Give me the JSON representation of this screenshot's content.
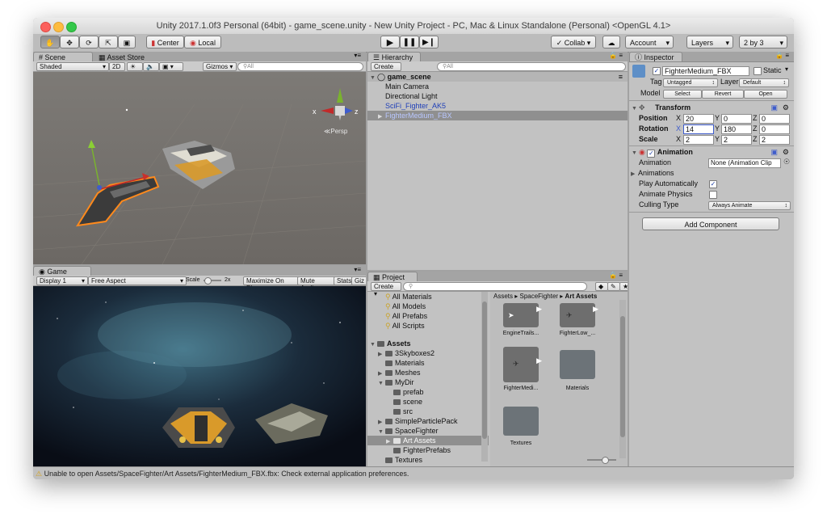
{
  "window": {
    "title": "Unity 2017.1.0f3 Personal (64bit) - game_scene.unity - New Unity Project - PC, Mac & Linux Standalone (Personal) <OpenGL 4.1>"
  },
  "toolbar": {
    "center_label": "Center",
    "local_label": "Local",
    "collab_label": "Collab",
    "account_label": "Account",
    "layers_label": "Layers",
    "layout_label": "2 by 3"
  },
  "scene": {
    "tab_label": "Scene",
    "asset_store_label": "Asset Store",
    "shading": "Shaded",
    "mode_2d": "2D",
    "gizmos_label": "Gizmos",
    "search_placeholder": "All",
    "persp_label": "Persp",
    "axis_x": "x",
    "axis_z": "z"
  },
  "game": {
    "tab_label": "Game",
    "display": "Display 1",
    "aspect": "Free Aspect",
    "scale_label": "Scale",
    "scale_value": "2x",
    "maximize_label": "Maximize On Play",
    "mute_label": "Mute Audio",
    "stats_label": "Stats",
    "gizmos_label": "Giz"
  },
  "hierarchy": {
    "tab_label": "Hierarchy",
    "create_label": "Create",
    "search_placeholder": "All",
    "scene_name": "game_scene",
    "items": [
      "Main Camera",
      "Directional Light",
      "SciFi_Fighter_AK5",
      "FighterMedium_FBX"
    ]
  },
  "project": {
    "tab_label": "Project",
    "create_label": "Create",
    "favorites": [
      "All Materials",
      "All Models",
      "All Prefabs",
      "All Scripts"
    ],
    "tree": {
      "assets": "Assets",
      "skyboxes": "3Skyboxes2",
      "materials": "Materials",
      "meshes": "Meshes",
      "mydir": "MyDir",
      "prefab": "prefab",
      "scene": "scene",
      "src": "src",
      "particle": "SimpleParticlePack",
      "spacefighter": "SpaceFighter",
      "artassets": "Art Assets",
      "fighterprefabs": "FighterPrefabs",
      "textures": "Textures"
    },
    "breadcrumb": [
      "Assets",
      "SpaceFighter",
      "Art Assets"
    ],
    "assets": [
      "EngineTrails...",
      "FighterLow_...",
      "FighterMedi...",
      "Materials",
      "Textures"
    ]
  },
  "inspector": {
    "tab_label": "Inspector",
    "object_name": "FighterMedium_FBX",
    "static_label": "Static",
    "tag_label": "Tag",
    "tag_value": "Untagged",
    "layer_label": "Layer",
    "layer_value": "Default",
    "model_label": "Model",
    "select_label": "Select",
    "revert_label": "Revert",
    "open_label": "Open",
    "transform": {
      "title": "Transform",
      "position_label": "Position",
      "rotation_label": "Rotation",
      "scale_label": "Scale",
      "position": {
        "x": "20",
        "y": "0",
        "z": "0"
      },
      "rotation": {
        "x": "14",
        "y": "180",
        "z": "0"
      },
      "scale": {
        "x": "2",
        "y": "2",
        "z": "2"
      }
    },
    "animation": {
      "title": "Animation",
      "animation_label": "Animation",
      "animation_value": "None (Animation Clip",
      "animations_label": "Animations",
      "play_auto_label": "Play Automatically",
      "play_auto_checked": true,
      "physics_label": "Animate Physics",
      "physics_checked": false,
      "culling_label": "Culling Type",
      "culling_value": "Always Animate"
    },
    "add_component_label": "Add Component"
  },
  "status": {
    "message": "Unable to open Assets/SpaceFighter/Art Assets/FighterMedium_FBX.fbx: Check external application preferences."
  },
  "colors": {
    "accent": "#3e5ccc",
    "prefab_text": "#1f3fb8"
  }
}
